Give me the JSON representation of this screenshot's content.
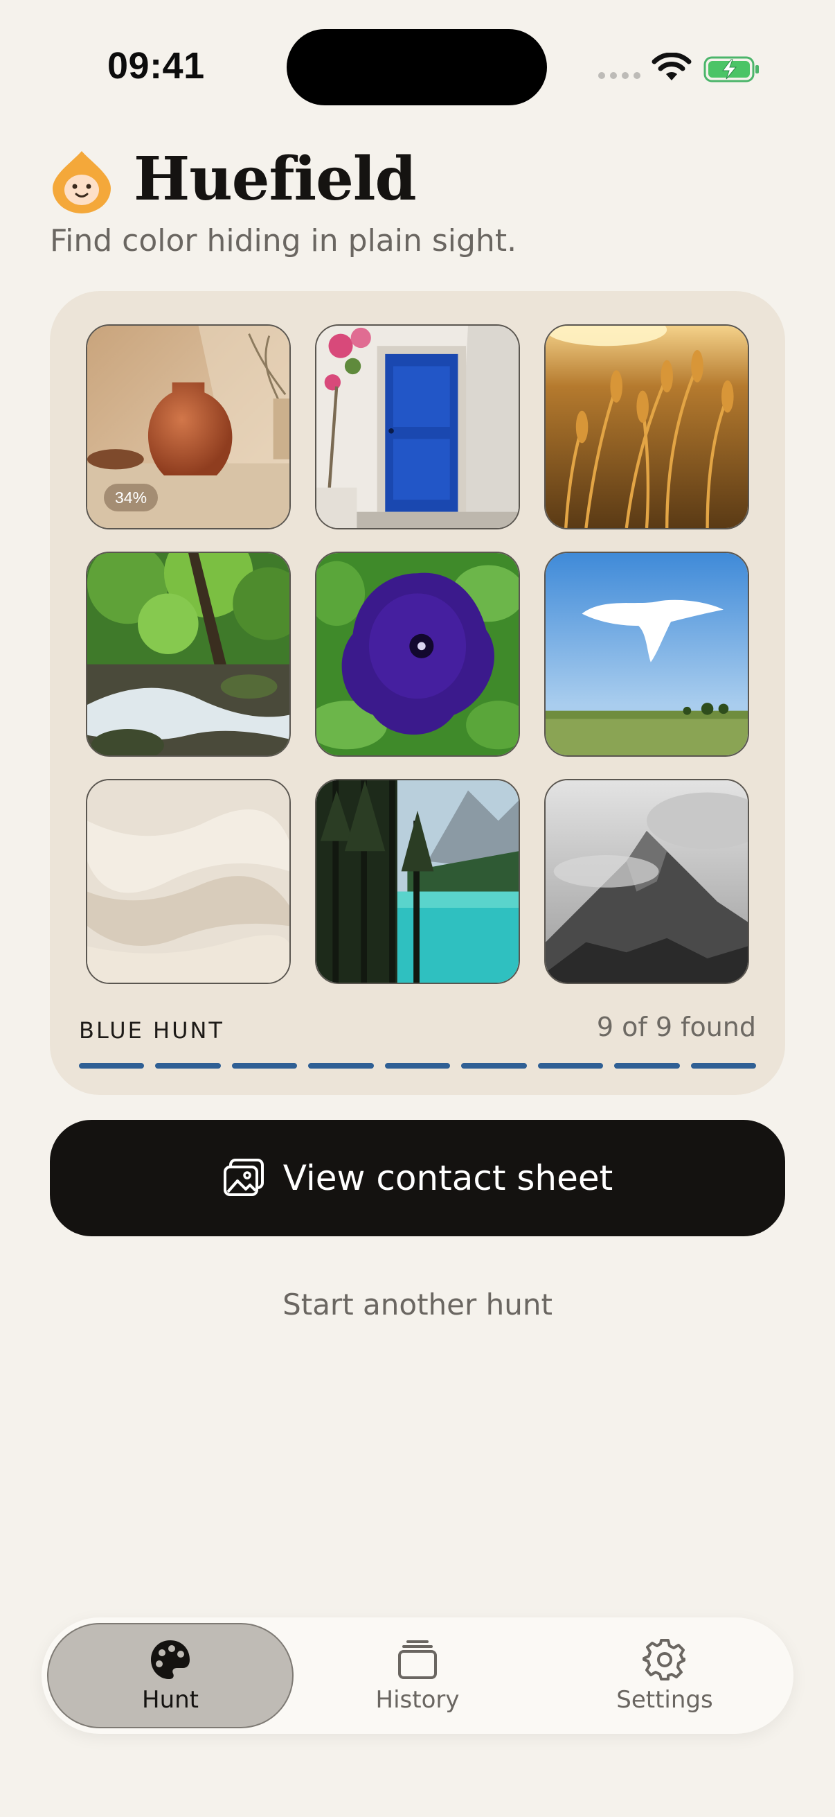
{
  "status_bar": {
    "time": "09:41"
  },
  "header": {
    "app_name": "Huefield",
    "tagline": "Find color hiding in plain sight."
  },
  "hunt": {
    "label": "BLUE HUNT",
    "found_text": "9 of 9 found",
    "progress": {
      "found": 9,
      "total": 9
    },
    "tiles": [
      {
        "subject": "terracotta vase",
        "badge": "34%"
      },
      {
        "subject": "blue door"
      },
      {
        "subject": "golden grass"
      },
      {
        "subject": "forest stream"
      },
      {
        "subject": "purple petunia"
      },
      {
        "subject": "sky and field"
      },
      {
        "subject": "linen fabric"
      },
      {
        "subject": "turquoise lake"
      },
      {
        "subject": "misty mountain"
      }
    ]
  },
  "actions": {
    "primary_label": "View contact sheet",
    "primary_icon": "photos-icon",
    "secondary_label": "Start another hunt"
  },
  "tab_bar": {
    "tabs": [
      {
        "label": "Hunt",
        "icon": "palette-icon",
        "active": true
      },
      {
        "label": "History",
        "icon": "stack-icon",
        "active": false
      },
      {
        "label": "Settings",
        "icon": "gear-icon",
        "active": false
      }
    ]
  },
  "colors": {
    "background": "#f5f2ec",
    "card": "#ece4d8",
    "accent_blue": "#2f5f94",
    "primary_button": "#141210",
    "logo_orange": "#f4a83a"
  }
}
